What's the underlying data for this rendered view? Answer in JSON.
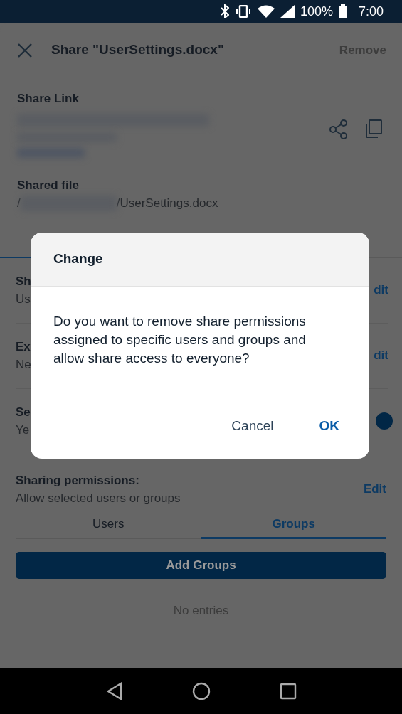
{
  "status_bar": {
    "battery": "100%",
    "time": "7:00"
  },
  "header": {
    "title": "Share \"UserSettings.docx\"",
    "action": "Remove"
  },
  "share_link": {
    "label": "Share Link"
  },
  "shared_file": {
    "label": "Shared file",
    "path_start": "/",
    "path_end": "/UserSettings.docx"
  },
  "settings_rows": [
    {
      "kind": "edit",
      "title": "Sh",
      "value": "Us",
      "action": "dit"
    },
    {
      "kind": "edit",
      "title": "Ex",
      "value": "Ne",
      "action": "dit"
    },
    {
      "kind": "toggle",
      "title": "Se",
      "value": "Ye",
      "on": true
    }
  ],
  "permissions": {
    "title": "Sharing permissions:",
    "value": "Allow selected users or groups",
    "action": "Edit"
  },
  "tabs": [
    {
      "label": "Users",
      "selected": false
    },
    {
      "label": "Groups",
      "selected": true
    }
  ],
  "add_button": "Add Groups",
  "empty_text": "No entries",
  "dialog": {
    "title": "Change",
    "message": "Do you want to remove share permissions assigned to specific users and groups and allow share access to everyone?",
    "buttons": [
      {
        "label": "Cancel",
        "primary": false
      },
      {
        "label": "OK",
        "primary": true
      }
    ]
  }
}
